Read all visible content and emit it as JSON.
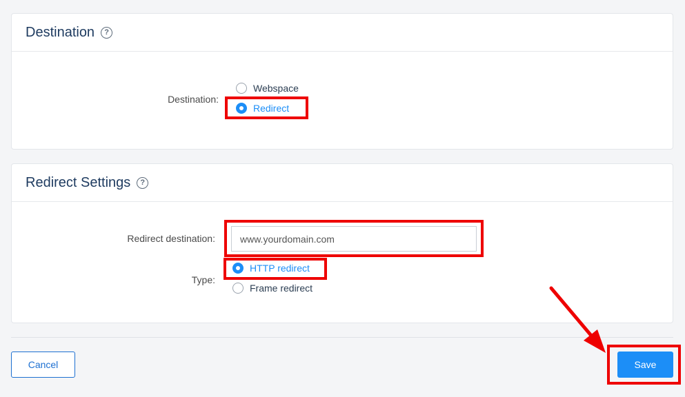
{
  "destination_panel": {
    "title": "Destination",
    "help_icon": "question-circle-icon",
    "field_label": "Destination:",
    "options": [
      {
        "label": "Webspace",
        "selected": false
      },
      {
        "label": "Redirect",
        "selected": true
      }
    ]
  },
  "redirect_panel": {
    "title": "Redirect Settings",
    "help_icon": "question-circle-icon",
    "destination_label": "Redirect destination:",
    "destination_placeholder": "www.yourdomain.com",
    "destination_value": "",
    "type_label": "Type:",
    "type_options": [
      {
        "label": "HTTP redirect",
        "selected": true
      },
      {
        "label": "Frame redirect",
        "selected": false
      }
    ]
  },
  "footer": {
    "cancel_label": "Cancel",
    "save_label": "Save"
  },
  "colors": {
    "accent": "#1c8ef7",
    "highlight": "#ee0000",
    "title": "#1d3a5f"
  }
}
